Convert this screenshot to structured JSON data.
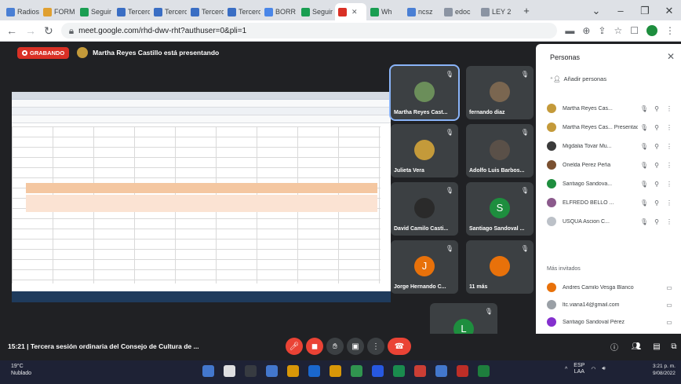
{
  "browser": {
    "tabs": [
      {
        "label": "Radios",
        "color": "#4a7fd4"
      },
      {
        "label": "FORM",
        "color": "#e0a030"
      },
      {
        "label": "Seguir",
        "color": "#1a9e52"
      },
      {
        "label": "Tercero",
        "color": "#3a6ec4"
      },
      {
        "label": "Tercero",
        "color": "#3a6ec4"
      },
      {
        "label": "Tercero",
        "color": "#3a6ec4"
      },
      {
        "label": "Tercero",
        "color": "#3a6ec4"
      },
      {
        "label": "BORR",
        "color": "#4a86e8"
      },
      {
        "label": "Seguir",
        "color": "#1a9e52"
      },
      {
        "label": "",
        "color": "#d93025",
        "active": true
      },
      {
        "label": "Wh",
        "color": "#1a9e52"
      },
      {
        "label": "ncsz",
        "color": "#4a7fd4"
      },
      {
        "label": "edoc",
        "color": "#8b94a3"
      },
      {
        "label": "LEY 2",
        "color": "#8b94a3"
      }
    ],
    "new_tab": "+",
    "url": "meet.google.com/rhd-dwv-rht?authuser=0&pli=1"
  },
  "meeting": {
    "recording_label": "GRABANDO",
    "presenting_text": "Martha Reyes Castillo está presentando",
    "title": "15:21 | Tercera sesión ordinaria del Consejo de Cultura de ..."
  },
  "tiles": [
    {
      "name": "Martha Reyes Cast...",
      "initial": "",
      "color": "#6b8e5a",
      "highlight": true
    },
    {
      "name": "fernando diaz",
      "initial": "",
      "color": "#7a6650"
    },
    {
      "name": "Julieta Vera",
      "initial": "",
      "color": "#c49a3a"
    },
    {
      "name": "Adolfo Luis Barbos...",
      "initial": "",
      "color": "#5a5048"
    },
    {
      "name": "David Camilo Casti...",
      "initial": "",
      "color": "#2a2a2a"
    },
    {
      "name": "Santiago Sandoval ...",
      "initial": "S",
      "color": "#1e8e3e"
    },
    {
      "name": "Jorge Hernando C...",
      "initial": "J",
      "color": "#e8710a"
    },
    {
      "name": "11 más",
      "initial": "",
      "color": "#e8710a"
    },
    {
      "name": "Tú",
      "initial": "L",
      "color": "#1e8e3e"
    }
  ],
  "panel": {
    "title": "Personas",
    "add_people": "Añadir personas",
    "participants": [
      {
        "name": "Martha Reyes Cas...",
        "color": "#c49a3a"
      },
      {
        "name": "Martha Reyes Cas... Presentación",
        "color": "#c49a3a"
      },
      {
        "name": "Migdalia Tovar Mu...",
        "color": "#3a3a3a"
      },
      {
        "name": "Onelda Perez Peña",
        "color": "#7a5030"
      },
      {
        "name": "Santiago Sandova...",
        "color": "#1e8e3e"
      },
      {
        "name": "ELFREDO BELLO ...",
        "color": "#8b5a8c"
      },
      {
        "name": "USQUA Ascion C...",
        "color": "#bcc1c8"
      }
    ],
    "invited_label": "Más invitados",
    "invited": [
      {
        "name": "Andres Camilo Vesga Blanco",
        "color": "#e8710a"
      },
      {
        "name": "ltc.viana14@gmail.com",
        "color": "#9aa0a6"
      },
      {
        "name": "Santiago Sandoval Pérez",
        "color": "#8430ce"
      }
    ]
  },
  "taskbar": {
    "temperature": "19°C",
    "weather": "Nublado",
    "language": "ESP",
    "language_sub": "LAA",
    "time": "3:21 p. m.",
    "date": "9/08/2022"
  },
  "colors": {
    "meet_bg": "#202124",
    "hangup": "#ea4335",
    "recording": "#d93025"
  }
}
